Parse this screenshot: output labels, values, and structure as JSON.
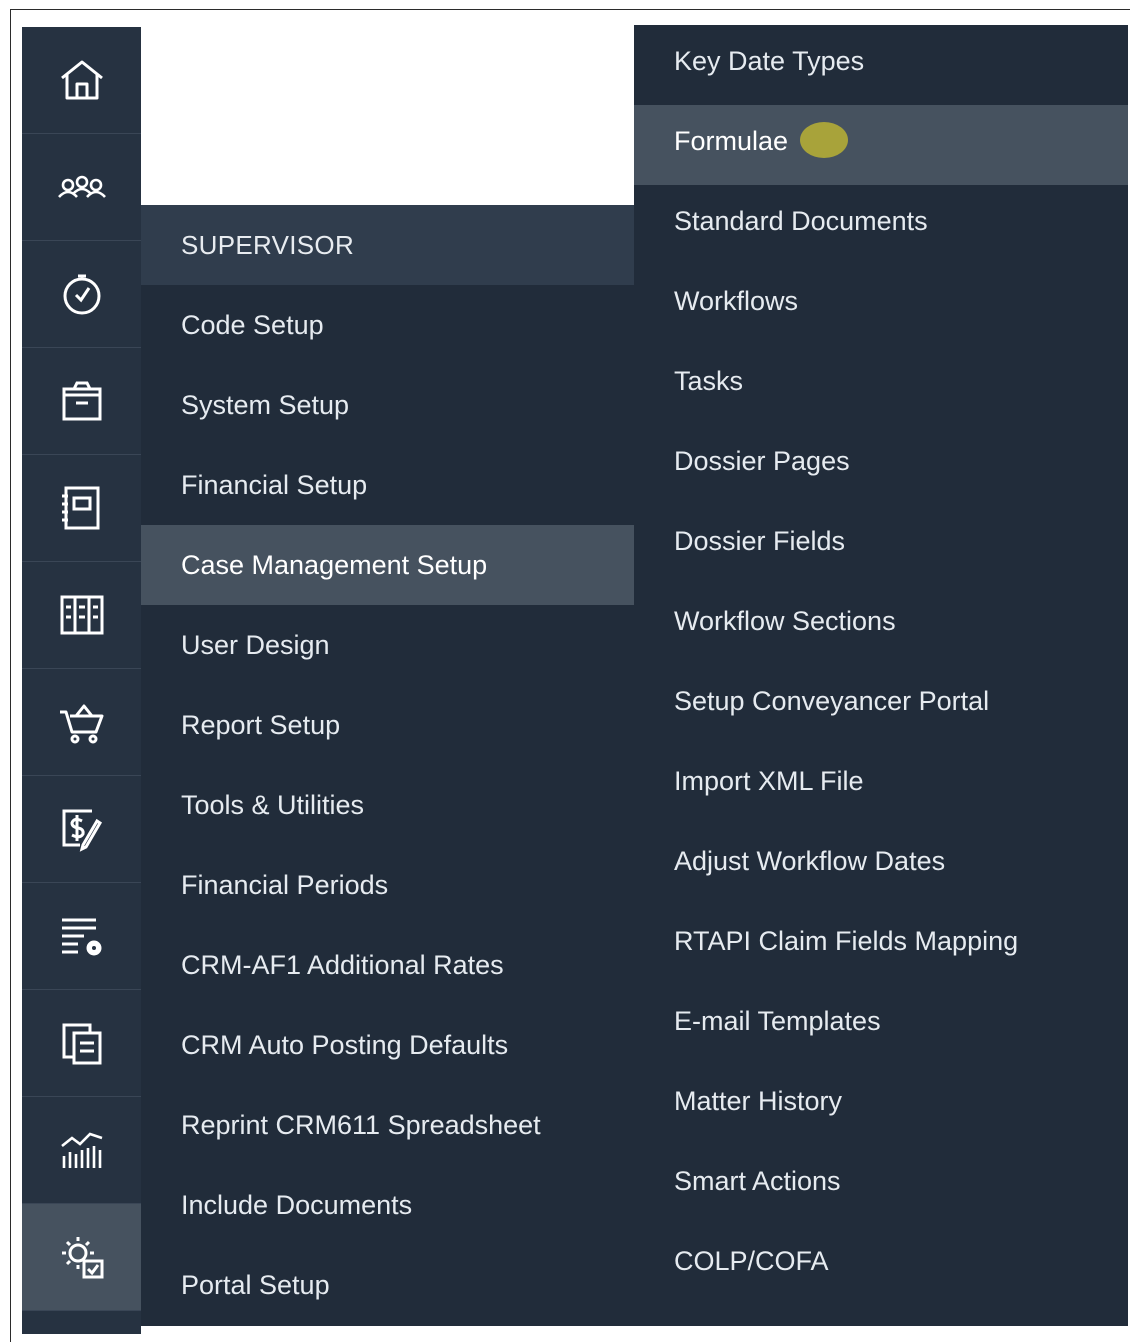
{
  "rail": {
    "items": [
      {
        "icon": "home-icon"
      },
      {
        "icon": "contacts-icon"
      },
      {
        "icon": "time-icon"
      },
      {
        "icon": "matters-icon"
      },
      {
        "icon": "documents-icon"
      },
      {
        "icon": "ledger-icon"
      },
      {
        "icon": "cart-icon"
      },
      {
        "icon": "billing-icon"
      },
      {
        "icon": "reports-settings-icon"
      },
      {
        "icon": "copy-records-icon"
      },
      {
        "icon": "analytics-icon"
      },
      {
        "icon": "supervisor-settings-icon"
      }
    ]
  },
  "supervisor": {
    "header": "SUPERVISOR",
    "items": [
      {
        "label": "Code Setup"
      },
      {
        "label": "System Setup"
      },
      {
        "label": "Financial Setup"
      },
      {
        "label": "Case Management Setup"
      },
      {
        "label": "User Design"
      },
      {
        "label": "Report Setup"
      },
      {
        "label": "Tools & Utilities"
      },
      {
        "label": "Financial Periods"
      },
      {
        "label": "CRM-AF1 Additional Rates"
      },
      {
        "label": "CRM Auto Posting Defaults"
      },
      {
        "label": "Reprint CRM611 Spreadsheet"
      },
      {
        "label": "Include Documents"
      },
      {
        "label": "Portal Setup"
      }
    ]
  },
  "submenu": {
    "items": [
      {
        "label": "Key Date Types"
      },
      {
        "label": "Formulae"
      },
      {
        "label": "Standard Documents"
      },
      {
        "label": "Workflows"
      },
      {
        "label": "Tasks"
      },
      {
        "label": "Dossier Pages"
      },
      {
        "label": "Dossier Fields"
      },
      {
        "label": "Workflow Sections"
      },
      {
        "label": "Setup Conveyancer Portal"
      },
      {
        "label": "Import XML File"
      },
      {
        "label": "Adjust Workflow Dates"
      },
      {
        "label": "RTAPI Claim Fields Mapping"
      },
      {
        "label": "E-mail Templates"
      },
      {
        "label": "Matter History"
      },
      {
        "label": "Smart Actions"
      },
      {
        "label": "COLP/COFA"
      }
    ]
  },
  "colors": {
    "rail_bg": "#263241",
    "panel_bg": "#212c3a",
    "active_bg": "#46525f",
    "cursor_highlight": "#a8a33a"
  }
}
